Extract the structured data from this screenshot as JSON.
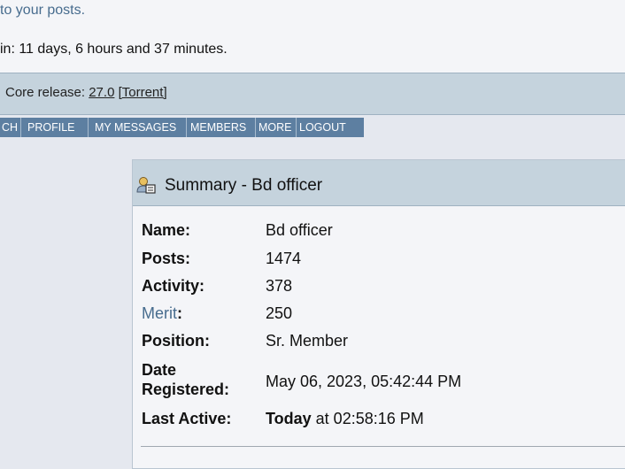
{
  "top": {
    "posts_link": "to your posts.",
    "time_online": "in: 11 days, 6 hours and 37 minutes."
  },
  "release_bar": {
    "prefix": "Core release: ",
    "version": "27.0",
    "torrent": "[Torrent]"
  },
  "menu": {
    "items": [
      "CH",
      "PROFILE",
      "MY MESSAGES",
      "MEMBERS",
      "MORE",
      "LOGOUT"
    ]
  },
  "summary": {
    "title": "Summary - Bd officer",
    "icon": "user-card-icon",
    "fields": {
      "name_label": "Name:",
      "name_value": "Bd officer",
      "posts_label": "Posts:",
      "posts_value": "1474",
      "activity_label": "Activity:",
      "activity_value": "378",
      "merit_label": "Merit",
      "merit_colon": ":",
      "merit_value": "250",
      "position_label": "Position:",
      "position_value": "Sr. Member",
      "date_label_line1": "Date",
      "date_label_line2": "Registered:",
      "date_value": "May 06, 2023, 05:42:44 PM",
      "last_active_label": "Last Active:",
      "last_active_today": "Today",
      "last_active_rest": " at 02:58:16 PM"
    }
  },
  "colors": {
    "bar_bg": "#c5d3dd",
    "menu_bg": "#5d7fa1",
    "link": "#476c8e",
    "page_bg": "#e5e8ef"
  }
}
